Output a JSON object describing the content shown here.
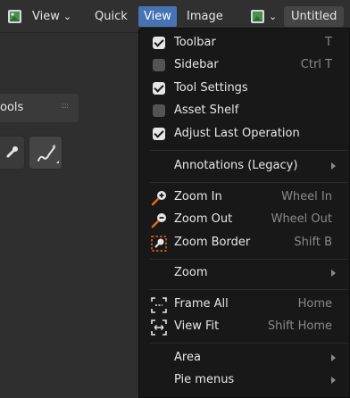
{
  "header": {
    "partial_view_label": "View",
    "quick_label": "Quick",
    "view_label": "View",
    "image_label": "Image",
    "untitled_label": "Untitled"
  },
  "left_panel": {
    "tools_tab_label": "ools"
  },
  "menu": {
    "items": [
      {
        "label": "Toolbar",
        "shortcut": "T",
        "checked": true
      },
      {
        "label": "Sidebar",
        "shortcut": "Ctrl T",
        "checked": false
      },
      {
        "label": "Tool Settings",
        "shortcut": "",
        "checked": true
      },
      {
        "label": "Asset Shelf",
        "shortcut": "",
        "checked": false
      },
      {
        "label": "Adjust Last Operation",
        "shortcut": "",
        "checked": true
      }
    ],
    "annotations_label": "Annotations (Legacy)",
    "zoom_in_label": "Zoom In",
    "zoom_in_shortcut": "Wheel In",
    "zoom_out_label": "Zoom Out",
    "zoom_out_shortcut": "Wheel Out",
    "zoom_border_label": "Zoom Border",
    "zoom_border_shortcut": "Shift B",
    "zoom_label": "Zoom",
    "frame_all_label": "Frame All",
    "frame_all_shortcut": "Home",
    "view_fit_label": "View Fit",
    "view_fit_shortcut": "Shift Home",
    "area_label": "Area",
    "pie_menus_label": "Pie menus"
  },
  "colors": {
    "accent": "#4772b3",
    "menu_bg": "#181818",
    "header_bg": "#303030"
  }
}
